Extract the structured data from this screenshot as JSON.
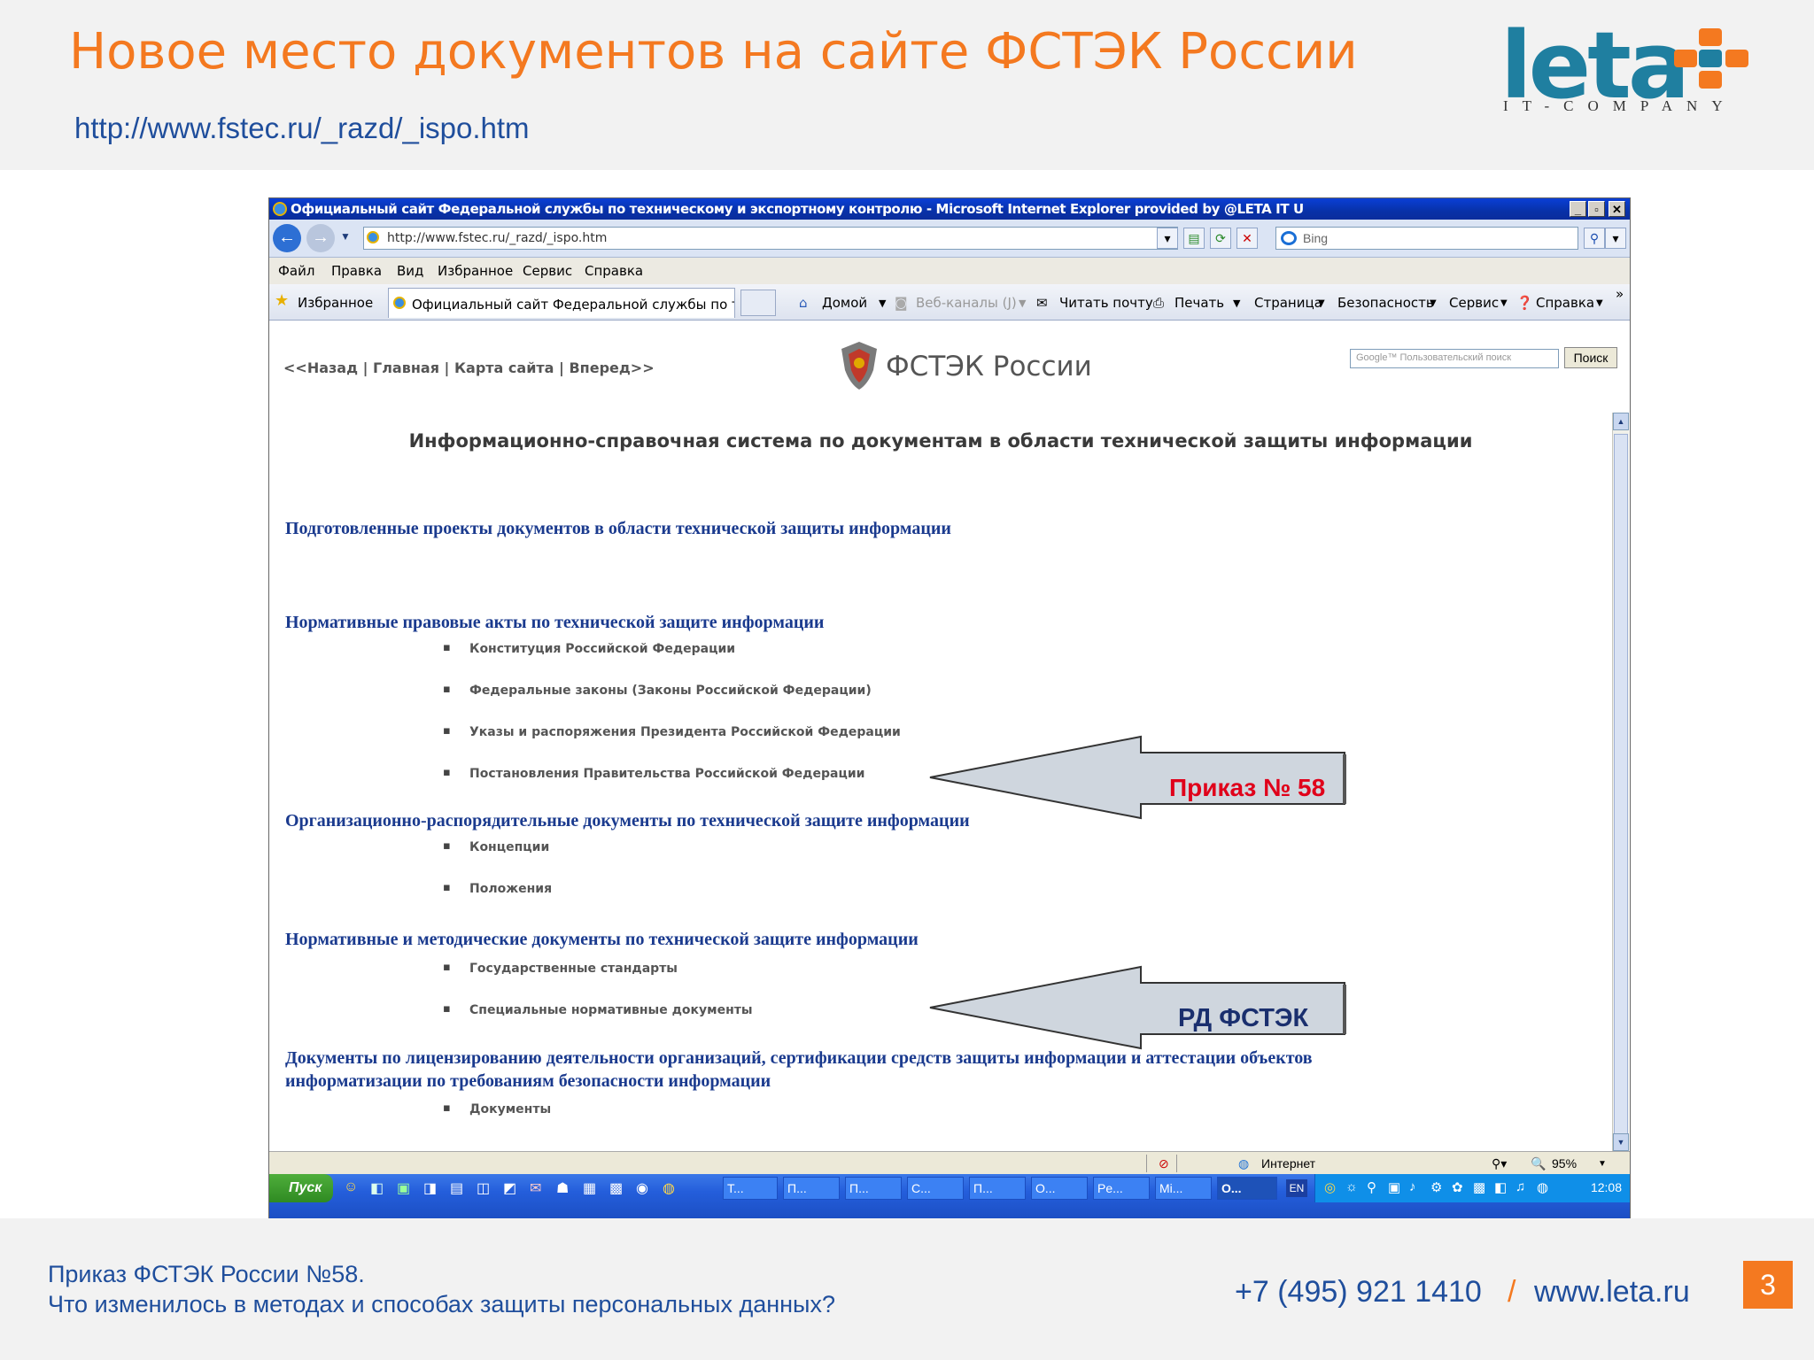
{
  "slide": {
    "title": "Новое место документов на сайте ФСТЭК России",
    "url": "http://www.fstec.ru/_razd/_ispo.htm",
    "logo": {
      "word": "leta",
      "subtitle": "IT-COMPANY"
    }
  },
  "browser": {
    "title": "Официальный сайт Федеральной службы по техническому и экспортному контролю - Microsoft Internet Explorer provided by @LETA IT U",
    "address": "http://www.fstec.ru/_razd/_ispo.htm",
    "search_placeholder": "Bing",
    "menu": [
      "Файл",
      "Правка",
      "Вид",
      "Избранное",
      "Сервис",
      "Справка"
    ],
    "favorites_label": "Избранное",
    "tab_label": "Официальный сайт Федеральной службы по техни...",
    "toolbar": {
      "home": "Домой",
      "feeds": "Веб-каналы (J)",
      "mail": "Читать почту",
      "print": "Печать",
      "page": "Страница",
      "safety": "Безопасность",
      "tools": "Сервис",
      "help": "Справка"
    },
    "status": {
      "zone": "Интернет",
      "zoom": "95%"
    }
  },
  "site": {
    "nav": "<<Назад | Главная | Карта сайта | Вперед>>",
    "logo_text": "ФСТЭК России",
    "google_placeholder": "Google™ Пользовательский поиск",
    "search_button": "Поиск",
    "heading": "Информационно-справочная система по документам в области технической защиты информации",
    "sections": [
      {
        "title": "Подготовленные проекты документов в области технической защиты информации",
        "items": []
      },
      {
        "title": "Нормативные правовые акты по технической защите информации",
        "items": [
          "Конституция Российской Федерации",
          "Федеральные законы (Законы Российской Федерации)",
          "Указы и распоряжения Президента Российской Федерации",
          "Постановления Правительства Российской Федерации"
        ]
      },
      {
        "title": "Организационно-распорядительные документы по технической защите информации",
        "items": [
          "Концепции",
          "Положения"
        ]
      },
      {
        "title": "Нормативные и методические документы по технической защите информации",
        "items": [
          "Государственные стандарты",
          "Специальные нормативные документы"
        ]
      },
      {
        "title_line1": "Документы по лицензированию деятельности организаций, сертификации средств защиты информации и аттестации объектов",
        "title_line2": "информатизации по требованиям безопасности информации",
        "items": [
          "Документы"
        ]
      }
    ],
    "callouts": {
      "order": "Приказ № 58",
      "rd": "РД ФСТЭК"
    }
  },
  "taskbar": {
    "start": "Пуск",
    "tasks": [
      "T...",
      "П...",
      "П...",
      "C...",
      "П...",
      "O...",
      "Pe...",
      "Mi...",
      "O..."
    ],
    "lang": "EN",
    "clock": "12:08"
  },
  "footer": {
    "line1": "Приказ ФСТЭК России №58.",
    "line2": "Что изменилось в методах и способах защиты персональных данных?",
    "phone": "+7 (495) 921 1410",
    "separator": "/",
    "site": "www.leta.ru",
    "page": "3"
  },
  "colors": {
    "accent": "#f47920",
    "link": "#1f4e9c",
    "brand": "#1f7fa0",
    "callout_red": "#e0001a",
    "callout_navy": "#1a2f6e"
  }
}
